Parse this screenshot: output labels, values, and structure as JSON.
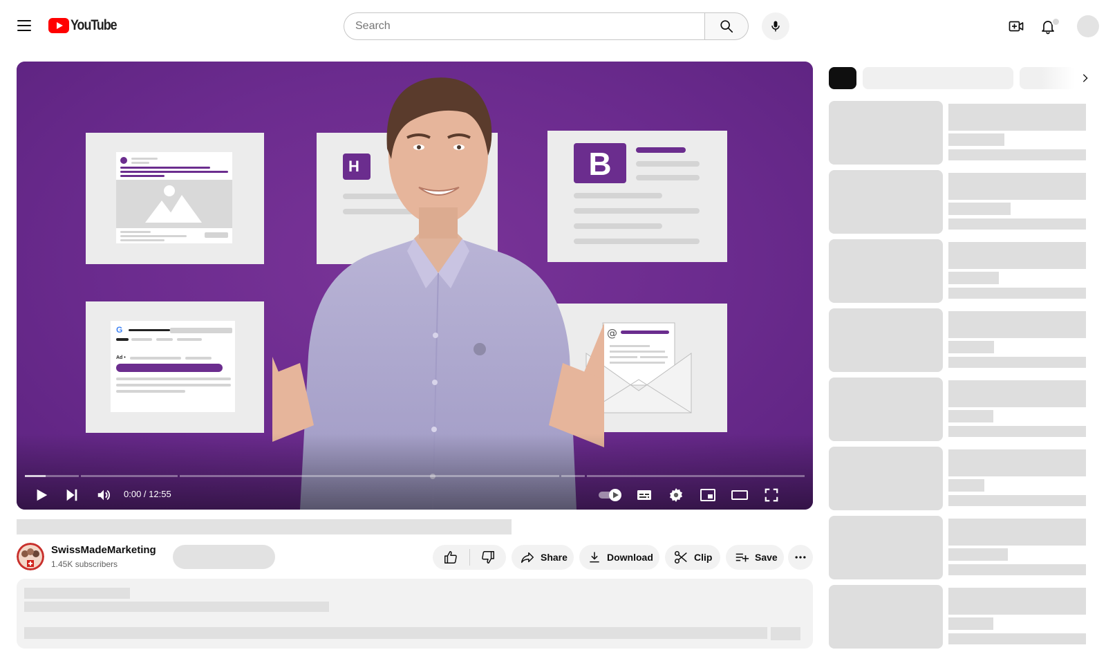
{
  "header": {
    "logo_text": "YouTube",
    "search_placeholder": "Search",
    "icons": [
      "menu-icon",
      "search-icon",
      "mic-icon",
      "create-icon",
      "bell-icon"
    ]
  },
  "player": {
    "time": "0:00 / 12:55",
    "watched_fraction": 0.0,
    "card_letters": {
      "b_logo": "B",
      "h_logo": "H"
    },
    "card_labels": {
      "ad": "Ad •",
      "at": "@"
    },
    "control_icons": [
      "play-icon",
      "next-icon",
      "volume-icon",
      "autoplay-toggle",
      "subtitles-icon",
      "settings-gear-icon",
      "miniplayer-icon",
      "theater-icon",
      "fullscreen-icon"
    ]
  },
  "channel": {
    "name": "SwissMadeMarketing",
    "subscribers": "1.45K subscribers"
  },
  "actions": {
    "share": "Share",
    "download": "Download",
    "clip": "Clip",
    "save": "Save"
  },
  "colors": {
    "brand_red": "#ff0000",
    "player_purple": "#6a2b8c",
    "skeleton": "#e2e2e2"
  }
}
